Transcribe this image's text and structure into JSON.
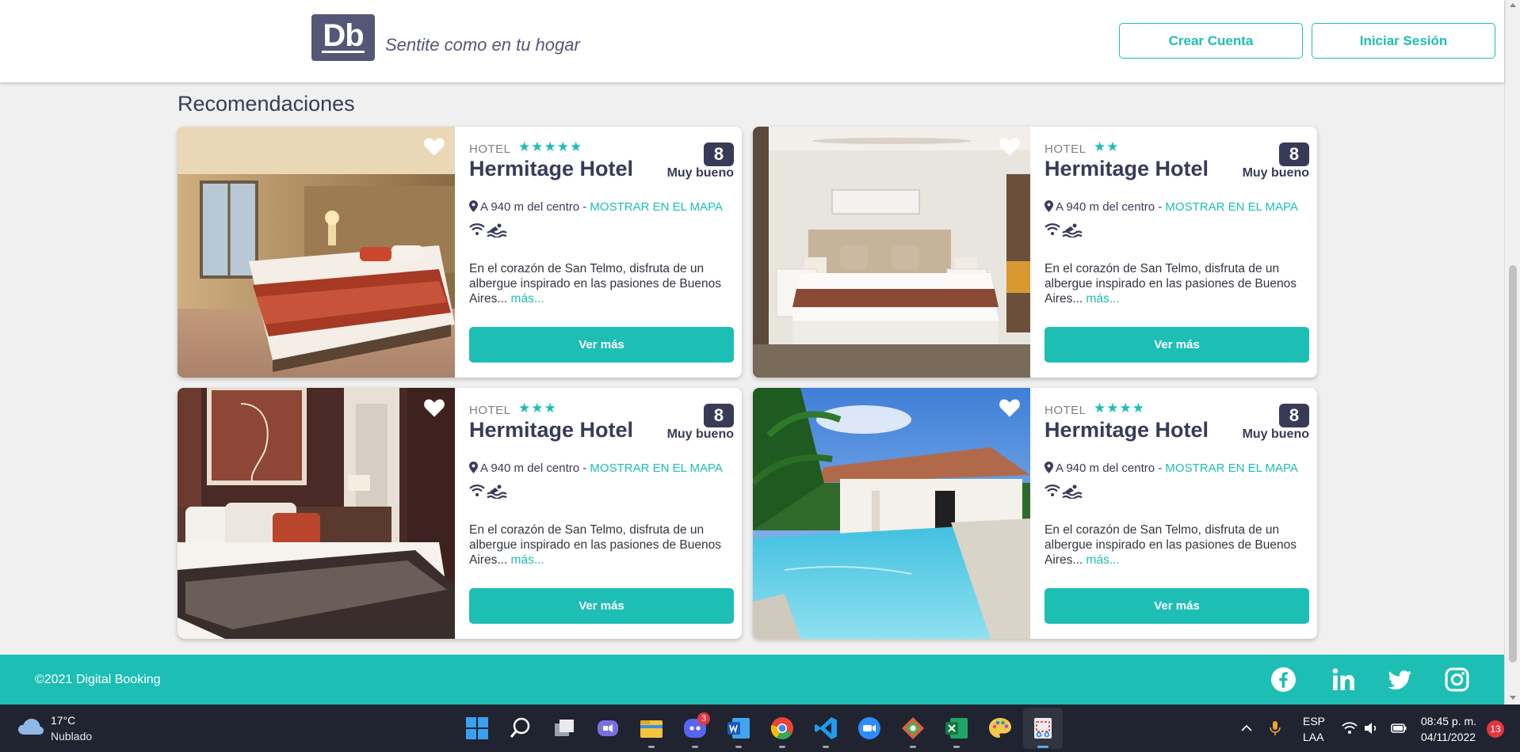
{
  "header": {
    "logo_text": "Db",
    "slogan": "Sentite como en tu hogar",
    "create_account_label": "Crear Cuenta",
    "login_label": "Iniciar Sesión"
  },
  "section_title": "Recomendaciones",
  "cards": [
    {
      "category": "HOTEL",
      "stars": "★★★★★",
      "star_count": 5,
      "name": "Hermitage Hotel",
      "score": "8",
      "score_label": "Muy bueno",
      "location": "A 940 m del centro - ",
      "map_link": "MOSTRAR EN EL MAPA",
      "amenities": [
        "wifi-icon",
        "pool-icon"
      ],
      "description": "En el corazón de San Telmo, disfruta de un albergue inspirado en las pasiones de Buenos Aires...",
      "more": "más...",
      "button": "Ver más",
      "image": "hotel-room-red-bed"
    },
    {
      "category": "HOTEL",
      "stars": "★★",
      "star_count": 2,
      "name": "Hermitage Hotel",
      "score": "8",
      "score_label": "Muy bueno",
      "location": "A 940 m del centro - ",
      "map_link": "MOSTRAR EN EL MAPA",
      "amenities": [
        "wifi-icon",
        "pool-icon"
      ],
      "description": "En el corazón de San Telmo, disfruta de un albergue inspirado en las pasiones de Buenos Aires...",
      "more": "más...",
      "button": "Ver más",
      "image": "hotel-room-white-bed"
    },
    {
      "category": "HOTEL",
      "stars": "★★★",
      "star_count": 3,
      "name": "Hermitage Hotel",
      "score": "8",
      "score_label": "Muy bueno",
      "location": "A 940 m del centro - ",
      "map_link": "MOSTRAR EN EL MAPA",
      "amenities": [
        "wifi-icon",
        "pool-icon"
      ],
      "description": "En el corazón de San Telmo, disfruta de un albergue inspirado en las pasiones de Buenos Aires...",
      "more": "más...",
      "button": "Ver más",
      "image": "hotel-room-dark-bed"
    },
    {
      "category": "HOTEL",
      "stars": "★★★★",
      "star_count": 4,
      "name": "Hermitage Hotel",
      "score": "8",
      "score_label": "Muy bueno",
      "location": "A 940 m del centro - ",
      "map_link": "MOSTRAR EN EL MAPA",
      "amenities": [
        "wifi-icon",
        "pool-icon"
      ],
      "description": "En el corazón de San Telmo, disfruta de un albergue inspirado en las pasiones de Buenos Aires...",
      "more": "más...",
      "button": "Ver más",
      "image": "hotel-pool-palms"
    }
  ],
  "footer": {
    "copyright": "©2021 Digital Booking",
    "social": [
      "facebook-icon",
      "linkedin-icon",
      "twitter-icon",
      "instagram-icon"
    ]
  },
  "taskbar": {
    "weather_temp": "17°C",
    "weather_desc": "Nublado",
    "discord_badge": "3",
    "lang_line1": "ESP",
    "lang_line2": "LAA",
    "time": "08:45 p. m.",
    "date": "04/11/2022",
    "notifications": "13",
    "colors": {
      "accent": "#1dbeb4",
      "primary": "#383b58",
      "logo_bg": "#545776"
    }
  }
}
